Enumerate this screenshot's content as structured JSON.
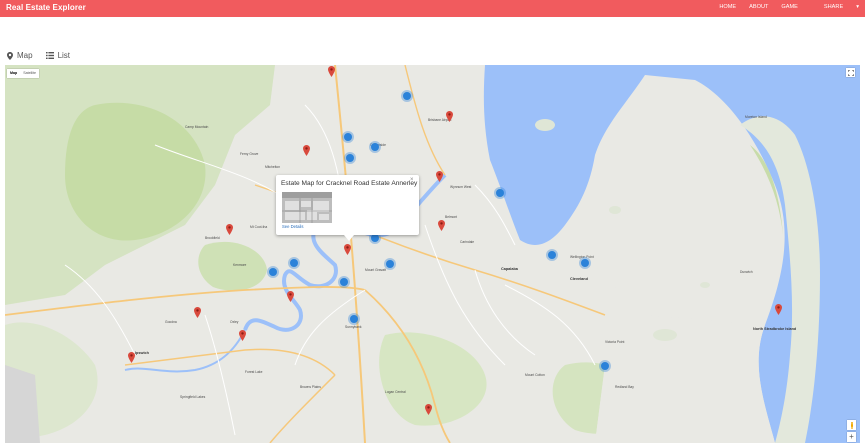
{
  "app": {
    "title": "Real Estate Explorer"
  },
  "nav": {
    "home": "HOME",
    "about": "ABOUT",
    "game": "GAME",
    "share": "SHARE"
  },
  "view_tabs": {
    "map": "Map",
    "list": "List"
  },
  "map_type": {
    "map": "Map",
    "satellite": "Satellite"
  },
  "info_window": {
    "title": "Estate Map for Cracknel Road Estate Annerley",
    "close": "×",
    "link": "See Details"
  },
  "place_labels": {
    "brisbane_airport": "Brisbane Airport",
    "wynnum_west": "Wynnum West",
    "capalaba": "Capalaba",
    "cleveland": "Cleveland",
    "ipswich": "Ipswich",
    "springfield_lakes": "Springfield Lakes",
    "logan_central": "Logan Central",
    "sunnybank": "Sunnybank",
    "mount_gravatt": "Mount Gravatt",
    "chermside": "Chermside",
    "brookfield": "Brookfield",
    "kenmore": "Kenmore",
    "forest_lake": "Forest Lake",
    "browns_plains": "Browns Plains",
    "redland_bay": "Redland Bay",
    "moreton_island": "Moreton Island",
    "bulimba": "Bulimba",
    "carindale": "Carindale",
    "victoria_point": "Victoria Point",
    "north_stradbroke_island": "North Stradbroke Island",
    "mount_cotton": "Mount Cotton",
    "oxley": "Oxley",
    "ferny_grove": "Ferny Grove",
    "wellington_point": "Wellington Point",
    "dunwich": "Dunwich",
    "goodna": "Goodna",
    "belmont": "Belmont",
    "mitchelton": "Mitchelton",
    "camp_mountain": "Camp Mountain",
    "mount_coot_tha": "Mt Coot-tha"
  },
  "colors": {
    "navbar": "#f15b5e",
    "water": "#9cc0f9",
    "land": "#e8e8e3",
    "park": "#c5dea4",
    "pin": "#d94a3d",
    "cluster": "#2b82d9"
  },
  "icons": {
    "map_tab": "map-marker-icon",
    "list_tab": "list-icon",
    "fullscreen": "fullscreen-icon",
    "pegman": "pegman-icon",
    "zoom_in": "plus-icon",
    "pin": "map-pin-icon",
    "cluster": "cluster-icon"
  },
  "zoom_in_label": "+"
}
